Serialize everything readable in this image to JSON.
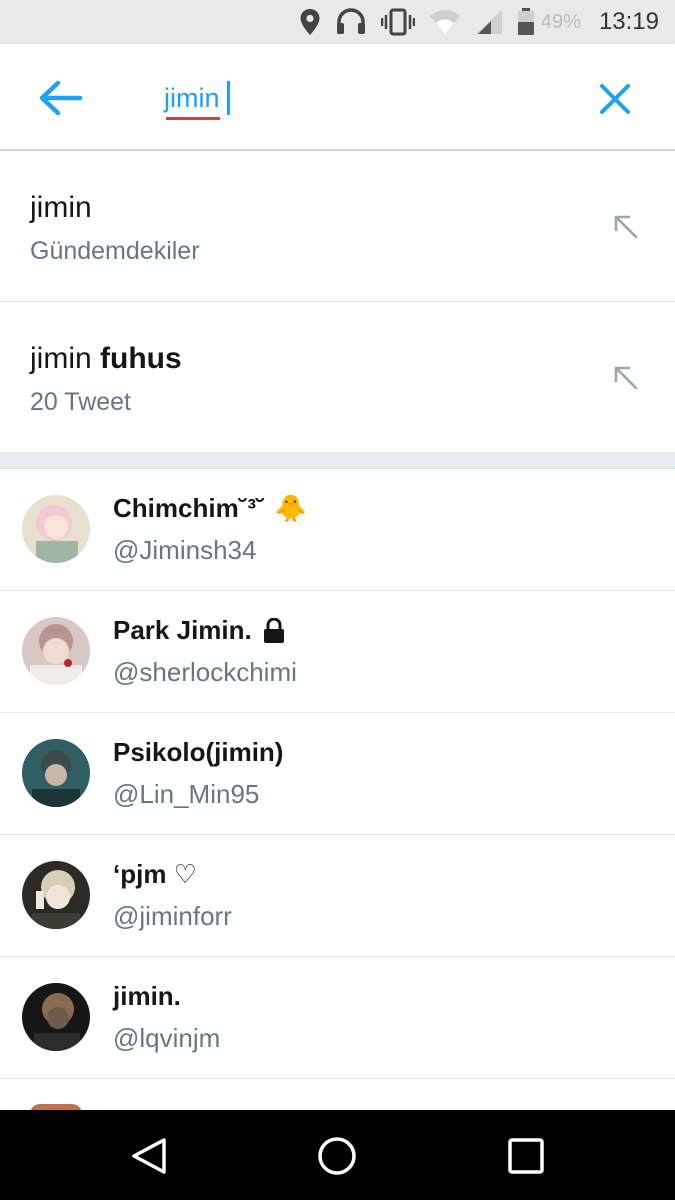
{
  "status_bar": {
    "icons": [
      "location-icon",
      "headset-icon",
      "vibrate-icon",
      "wifi-icon",
      "signal-icon",
      "battery-icon"
    ],
    "battery_percent": "49%",
    "time": "13:19"
  },
  "search": {
    "query": "jimin",
    "back_icon": "arrow-left-icon",
    "clear_icon": "close-icon",
    "accent_color": "#1da1f2"
  },
  "suggestions": [
    {
      "query": "jimin",
      "query_bold": "",
      "subtitle": "Gündemdekiler",
      "icon": "fill-query-arrow-icon"
    },
    {
      "query": "jimin ",
      "query_bold": "fuhus",
      "subtitle": "20 Tweet",
      "icon": "fill-query-arrow-icon"
    }
  ],
  "users": [
    {
      "name": "Chimchim˘³˘",
      "handle": "@Jiminsh34",
      "badge": "🐥"
    },
    {
      "name": "Park Jimin.",
      "handle": "@sherlockchimi",
      "badge": "lock-icon"
    },
    {
      "name": "Psikolo(jimin)",
      "handle": "@Lin_Min95",
      "badge": ""
    },
    {
      "name": "‘pjm ♡",
      "handle": "@jiminforr",
      "badge": ""
    },
    {
      "name": "jimin.",
      "handle": "@lqvinjm",
      "badge": ""
    }
  ],
  "nav": {
    "back": "nav-back-icon",
    "home": "nav-home-icon",
    "recents": "nav-recents-icon"
  }
}
